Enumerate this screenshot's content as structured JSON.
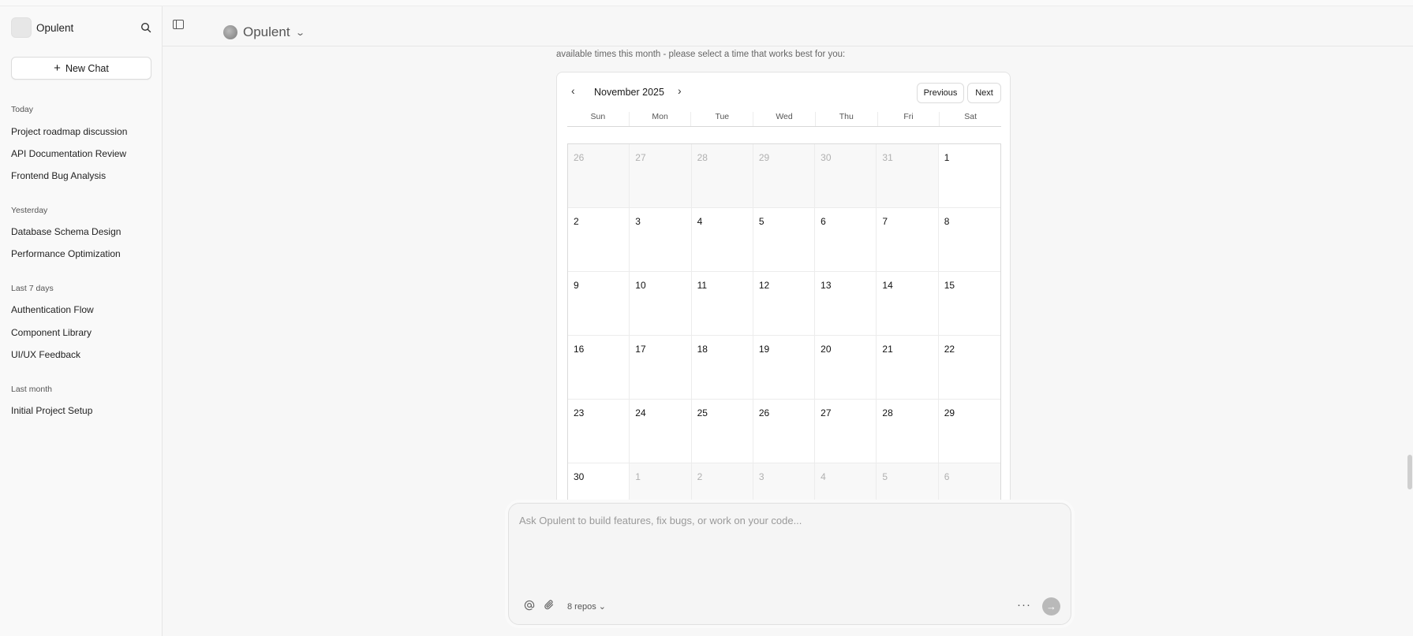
{
  "sidebar": {
    "workspace_name": "Opulent",
    "new_chat_label": "New Chat",
    "sections": [
      {
        "title": "Today",
        "items": [
          "Project roadmap discussion",
          "API Documentation Review",
          "Frontend Bug Analysis"
        ]
      },
      {
        "title": "Yesterday",
        "items": [
          "Database Schema Design",
          "Performance Optimization"
        ]
      },
      {
        "title": "Last 7 days",
        "items": [
          "Authentication Flow",
          "Component Library",
          "UI/UX Feedback"
        ]
      },
      {
        "title": "Last month",
        "items": [
          "Initial Project Setup"
        ]
      }
    ]
  },
  "header": {
    "model_name": "Opulent"
  },
  "message": {
    "text": "available times this month - please select a time that works best for you:"
  },
  "calendar": {
    "month_label": "November 2025",
    "previous_label": "Previous",
    "next_label": "Next",
    "weekdays": [
      "Sun",
      "Mon",
      "Tue",
      "Wed",
      "Thu",
      "Fri",
      "Sat"
    ],
    "days": [
      {
        "d": "26",
        "out": true
      },
      {
        "d": "27",
        "out": true
      },
      {
        "d": "28",
        "out": true
      },
      {
        "d": "29",
        "out": true
      },
      {
        "d": "30",
        "out": true
      },
      {
        "d": "31",
        "out": true
      },
      {
        "d": "1",
        "out": false
      },
      {
        "d": "2",
        "out": false
      },
      {
        "d": "3",
        "out": false
      },
      {
        "d": "4",
        "out": false
      },
      {
        "d": "5",
        "out": false
      },
      {
        "d": "6",
        "out": false
      },
      {
        "d": "7",
        "out": false
      },
      {
        "d": "8",
        "out": false
      },
      {
        "d": "9",
        "out": false
      },
      {
        "d": "10",
        "out": false
      },
      {
        "d": "11",
        "out": false
      },
      {
        "d": "12",
        "out": false
      },
      {
        "d": "13",
        "out": false
      },
      {
        "d": "14",
        "out": false
      },
      {
        "d": "15",
        "out": false
      },
      {
        "d": "16",
        "out": false
      },
      {
        "d": "17",
        "out": false
      },
      {
        "d": "18",
        "out": false
      },
      {
        "d": "19",
        "out": false
      },
      {
        "d": "20",
        "out": false
      },
      {
        "d": "21",
        "out": false
      },
      {
        "d": "22",
        "out": false
      },
      {
        "d": "23",
        "out": false
      },
      {
        "d": "24",
        "out": false
      },
      {
        "d": "25",
        "out": false
      },
      {
        "d": "26",
        "out": false
      },
      {
        "d": "27",
        "out": false
      },
      {
        "d": "28",
        "out": false
      },
      {
        "d": "29",
        "out": false
      },
      {
        "d": "30",
        "out": false
      },
      {
        "d": "1",
        "out": true
      },
      {
        "d": "2",
        "out": true
      },
      {
        "d": "3",
        "out": true
      },
      {
        "d": "4",
        "out": true
      },
      {
        "d": "5",
        "out": true
      },
      {
        "d": "6",
        "out": true
      }
    ]
  },
  "composer": {
    "placeholder": "Ask Opulent to build features, fix bugs, or work on your code...",
    "repos_label": "8 repos"
  },
  "icons": {
    "search": "search-icon",
    "sidebar_toggle": "sidebar-toggle-icon",
    "at": "at-icon",
    "attach": "paperclip-icon",
    "more": "more-icon",
    "send": "send-icon"
  }
}
